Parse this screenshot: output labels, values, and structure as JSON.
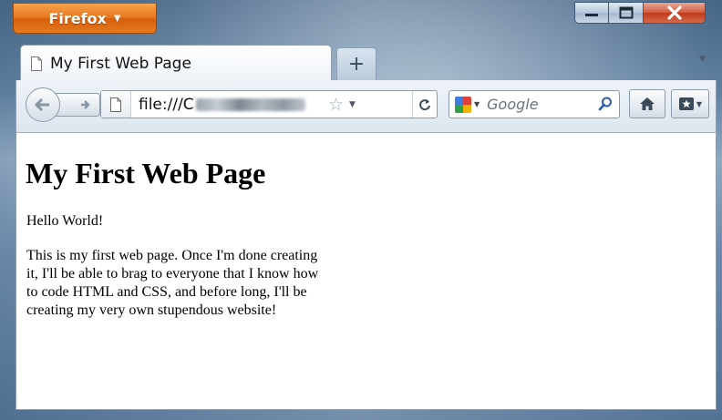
{
  "app": {
    "button_label": "Firefox"
  },
  "tab": {
    "title": "My First Web Page",
    "new_tab_label": "+"
  },
  "toolbar": {
    "url_prefix": "file:///C",
    "search_placeholder": "Google"
  },
  "page": {
    "heading": "My First Web Page",
    "paragraph1": "Hello World!",
    "paragraph2": "This is my first web page. Once I'm done creating it, I'll be able to brag to everyone that I know how to code HTML and CSS, and before long, I'll be creating my very own stupendous website!"
  },
  "colors": {
    "firefox_orange": "#e8771e",
    "close_red": "#c0391b"
  },
  "icons": [
    "page-icon",
    "back-arrow-icon",
    "forward-arrow-icon",
    "star-icon",
    "reload-icon",
    "google-icon",
    "search-icon",
    "home-icon",
    "bookmarks-icon",
    "minimize-icon",
    "maximize-icon",
    "close-icon"
  ]
}
